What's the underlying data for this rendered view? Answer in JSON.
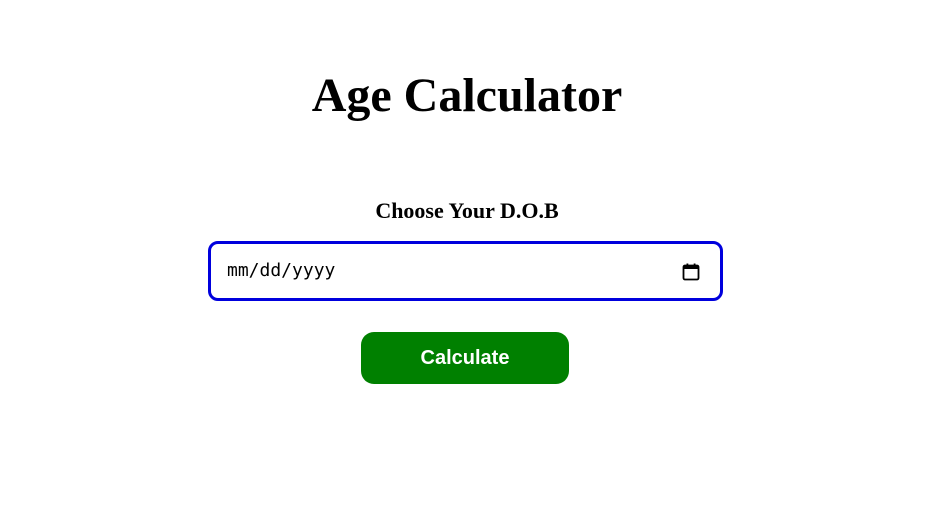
{
  "page": {
    "title": "Age Calculator"
  },
  "form": {
    "dob_label": "Choose Your D.O.B",
    "date_input": {
      "value": "",
      "placeholder": "mm/dd/yyyy",
      "icon": "calendar-icon"
    },
    "calculate_label": "Calculate"
  },
  "colors": {
    "input_border": "#0000dd",
    "button_background": "#008000",
    "button_text": "#ffffff"
  }
}
